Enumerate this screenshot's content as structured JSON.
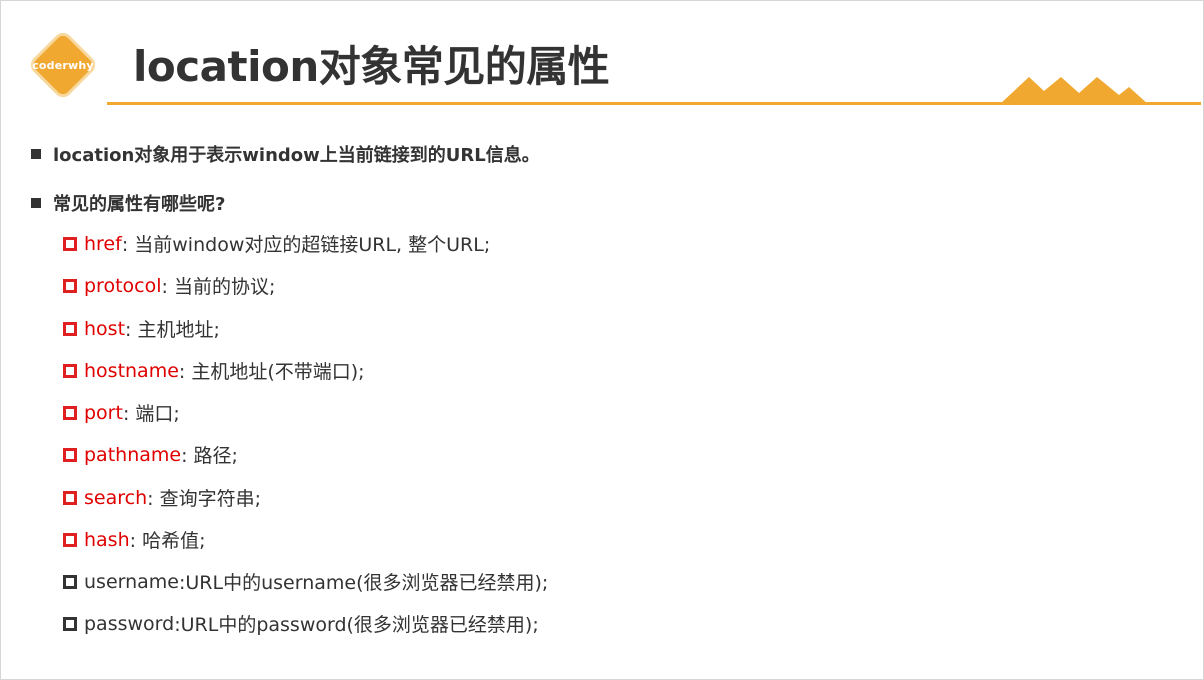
{
  "header": {
    "logo_text": "coderwhy",
    "title": "location对象常见的属性"
  },
  "colors": {
    "accent": "#f0a830",
    "text": "#333333",
    "key_red": "#e00000"
  },
  "bullets": [
    {
      "text": "location对象用于表示window上当前链接到的URL信息。"
    },
    {
      "text": "常见的属性有哪些呢?"
    }
  ],
  "properties": [
    {
      "key": "href",
      "desc": ": 当前window对应的超链接URL, 整个URL;",
      "style": "red"
    },
    {
      "key": "protocol",
      "desc": ": 当前的协议;",
      "style": "red"
    },
    {
      "key": "host",
      "desc": ": 主机地址;",
      "style": "red"
    },
    {
      "key": "hostname",
      "desc": ": 主机地址(不带端口);",
      "style": "red"
    },
    {
      "key": "port",
      "desc": ": 端口;",
      "style": "red"
    },
    {
      "key": "pathname",
      "desc": ": 路径;",
      "style": "red"
    },
    {
      "key": "search",
      "desc": ": 查询字符串;",
      "style": "red"
    },
    {
      "key": "hash",
      "desc": ": 哈希值;",
      "style": "red"
    },
    {
      "key": "username",
      "desc": ":URL中的username(很多浏览器已经禁用);",
      "style": "plain"
    },
    {
      "key": "password",
      "desc": ":URL中的password(很多浏览器已经禁用);",
      "style": "plain"
    }
  ]
}
